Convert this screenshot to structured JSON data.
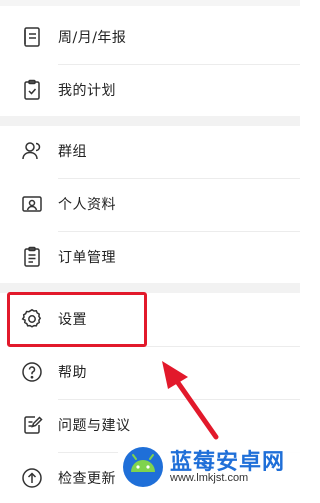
{
  "menu": {
    "items": [
      {
        "label": "周/月/年报",
        "icon": "report-icon"
      },
      {
        "label": "我的计划",
        "icon": "clipboard-check-icon"
      },
      {
        "label": "群组",
        "icon": "group-icon"
      },
      {
        "label": "个人资料",
        "icon": "profile-card-icon"
      },
      {
        "label": "订单管理",
        "icon": "order-list-icon"
      },
      {
        "label": "设置",
        "icon": "gear-icon"
      },
      {
        "label": "帮助",
        "icon": "help-icon"
      },
      {
        "label": "问题与建议",
        "icon": "feedback-edit-icon"
      },
      {
        "label": "检查更新",
        "icon": "update-icon"
      }
    ]
  },
  "annotation": {
    "highlight_color": "#e2192b",
    "highlighted_item": "设置"
  },
  "watermark": {
    "title": "蓝莓安卓网",
    "url": "www.lmkjst.com",
    "color": "#1f6fd8"
  }
}
